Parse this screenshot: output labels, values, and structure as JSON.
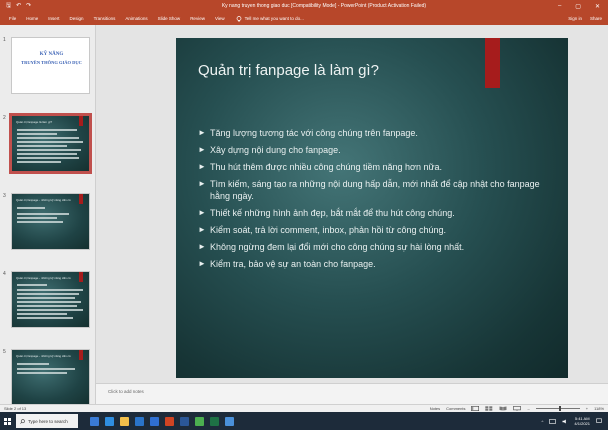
{
  "window": {
    "title": "Ky nang truyen thong giao duc [Compatibility Mode] - PowerPoint (Product Activation Failed)",
    "controls": [
      "–",
      "▢",
      "✕"
    ]
  },
  "quick_access": {
    "save": "🖫",
    "undo": "↶",
    "redo": "↷"
  },
  "ribbon": {
    "tabs": [
      "File",
      "Home",
      "Insert",
      "Design",
      "Transitions",
      "Animations",
      "Slide Show",
      "Review",
      "View"
    ],
    "tell_me": "Tell me what you want to do...",
    "sign_in": "Sign in",
    "share": "Share"
  },
  "thumbnails": [
    {
      "number": "1",
      "title_line1": "KỸ NĂNG",
      "title_line2": "TRUYỀN THÔNG GIÁO DỤC"
    },
    {
      "number": "2",
      "heading": "Quản trị fanpage là làm gì?"
    },
    {
      "number": "3",
      "heading": "Quản trị fanpage - những kỹ năng cần có"
    },
    {
      "number": "4",
      "heading": "Quản trị fanpage - những kỹ năng cần có"
    },
    {
      "number": "5",
      "heading": "Quản trị fanpage - những kỹ năng cần có"
    }
  ],
  "slide": {
    "title": "Quản trị fanpage là làm gì?",
    "bullets": [
      "Tăng lượng tương tác với công chúng trên fanpage.",
      "Xây dựng nội dung cho fanpage.",
      "Thu hút thêm được nhiều công chúng tiềm năng hơn nữa.",
      "Tìm kiếm, sáng tạo ra những nội dung hấp dẫn, mới nhất để cập nhật cho fanpage hằng ngày.",
      "Thiết kế những hình ảnh đẹp, bắt mắt để thu hút công chúng.",
      "Kiểm soát, trả lời comment, inbox, phản hồi từ công chúng.",
      "Không ngừng đem lại đổi mới cho công chúng sự hài lòng nhất.",
      "Kiểm tra, bảo vệ sự an toàn cho fanpage."
    ],
    "bullet_glyph": "►"
  },
  "notes": {
    "placeholder": "Click to add notes"
  },
  "statusbar": {
    "slide_counter": "Slide 2 of 13",
    "notes_label": "Notes",
    "comments_label": "Comments",
    "zoom": "118%"
  },
  "taskbar": {
    "search_placeholder": "Type here to search",
    "time": "5:41 AM",
    "date": "4/1/2021",
    "apps": [
      {
        "name": "task-view",
        "color": "#3a7bd5"
      },
      {
        "name": "edge",
        "color": "#2f8ee0"
      },
      {
        "name": "file-explorer",
        "color": "#f3c04b"
      },
      {
        "name": "store",
        "color": "#2a74c9"
      },
      {
        "name": "mail",
        "color": "#2f6fd1"
      },
      {
        "name": "powerpoint",
        "color": "#d04423"
      },
      {
        "name": "word",
        "color": "#2b5797"
      },
      {
        "name": "chrome",
        "color": "#4caf50"
      },
      {
        "name": "excel",
        "color": "#1e7145"
      },
      {
        "name": "photos",
        "color": "#4a90d9"
      }
    ]
  },
  "colors": {
    "ribbon": "#b7472a",
    "slide_bg": "#264f51",
    "accent_bar": "#a61c1c",
    "selected_outline": "#c0504d"
  }
}
